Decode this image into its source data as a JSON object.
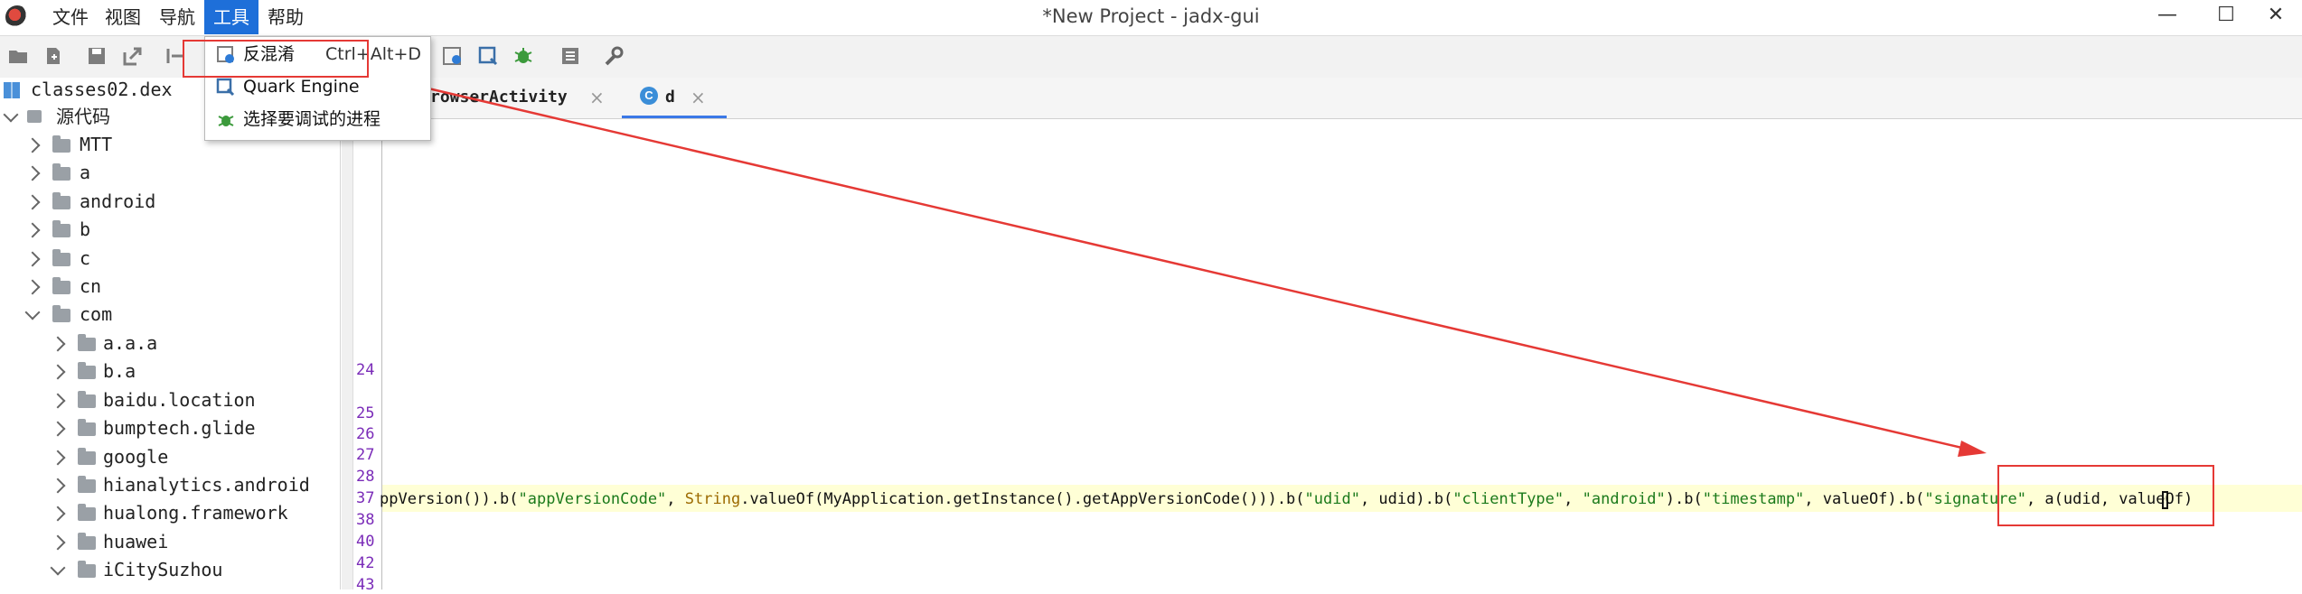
{
  "window": {
    "title": "*New Project - jadx-gui",
    "controls": [
      "—",
      "☐",
      "✕"
    ]
  },
  "menubar": {
    "items": [
      {
        "label": "文件"
      },
      {
        "label": "视图"
      },
      {
        "label": "导航"
      },
      {
        "label": "工具"
      },
      {
        "label": "帮助"
      }
    ]
  },
  "tools_menu": {
    "items": [
      {
        "label": "反混淆",
        "accelerator": "Ctrl+Alt+D"
      },
      {
        "label": "Quark Engine",
        "accelerator": ""
      },
      {
        "label": "选择要调试的进程",
        "accelerator": ""
      }
    ]
  },
  "tree": {
    "root": "classes02.dex",
    "source_label": "源代码",
    "packages": [
      "MTT",
      "a",
      "android",
      "b",
      "c",
      "cn",
      "com"
    ],
    "com_children": [
      "a.a.a",
      "b.a",
      "baidu.location",
      "bumptech.glide",
      "google",
      "hianalytics.android",
      "hualong.framework",
      "huawei",
      "iCitySuzhou"
    ]
  },
  "tabs": [
    {
      "label": "rowserActivity",
      "close": "×"
    },
    {
      "label": "d",
      "close": "×"
    }
  ],
  "editor": {
    "line_numbers": [
      "24",
      "25",
      "26",
      "27",
      "28",
      "37",
      "38",
      "40",
      "42",
      "43"
    ],
    "code_segments": [
      {
        "t": "ppVersion()).b(",
        "c": ""
      },
      {
        "t": "\"appVersionCode\"",
        "c": "s"
      },
      {
        "t": ", ",
        "c": ""
      },
      {
        "t": "String",
        "c": "k"
      },
      {
        "t": ".valueOf(MyApplication.getInstance().getAppVersionCode())).b(",
        "c": ""
      },
      {
        "t": "\"udid\"",
        "c": "s"
      },
      {
        "t": ", udid).b(",
        "c": ""
      },
      {
        "t": "\"clientType\"",
        "c": "s"
      },
      {
        "t": ", ",
        "c": ""
      },
      {
        "t": "\"android\"",
        "c": "s"
      },
      {
        "t": ").b(",
        "c": ""
      },
      {
        "t": "\"timestamp\"",
        "c": "s"
      },
      {
        "t": ", valueOf).b(",
        "c": ""
      },
      {
        "t": "\"signature\"",
        "c": "s"
      },
      {
        "t": ", a(udid, valueOf)",
        "c": ""
      }
    ]
  },
  "colors": {
    "menu_active": "#1e6fd9",
    "annotation_red": "#e53935",
    "string_literal": "#1b7a1b",
    "line_number": "#7a2bb8"
  }
}
